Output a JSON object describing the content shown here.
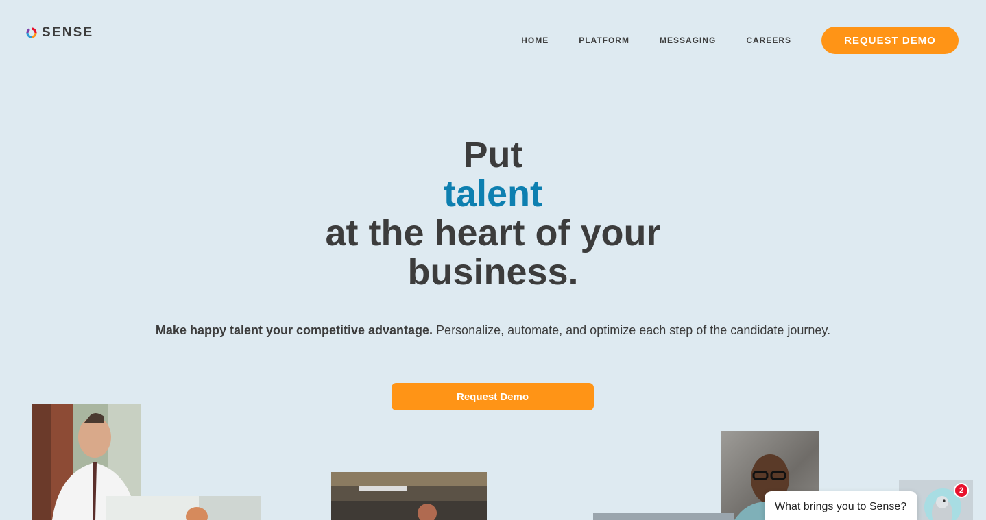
{
  "brand": {
    "name": "SENSE"
  },
  "nav": {
    "items": [
      {
        "label": "HOME"
      },
      {
        "label": "PLATFORM"
      },
      {
        "label": "MESSAGING"
      },
      {
        "label": "CAREERS"
      }
    ],
    "cta_label": "REQUEST DEMO"
  },
  "hero": {
    "line1": "Put",
    "line2": "talent",
    "line3": "at the heart of your",
    "line4": "business.",
    "sub_bold": "Make happy talent your competitive advantage.",
    "sub_rest": " Personalize, automate, and optimize each step of the candidate journey.",
    "cta_label": "Request Demo"
  },
  "chat": {
    "prompt": "What brings you to Sense?",
    "badge_count": "2"
  },
  "colors": {
    "background": "#deeaf1",
    "accent_orange": "#ff9416",
    "accent_blue": "#0d7fb0",
    "text_dark": "#3c3c3c",
    "badge_red": "#e8112d"
  }
}
